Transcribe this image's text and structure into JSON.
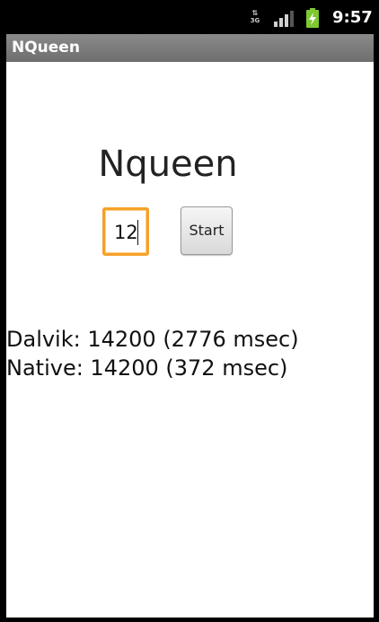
{
  "status_bar": {
    "network_type": "3G",
    "time": "9:57",
    "icons": [
      "data-arrows-icon",
      "signal-strength-icon",
      "battery-charging-icon"
    ],
    "battery_color": "#7ec832"
  },
  "app": {
    "title": "NQueen"
  },
  "main": {
    "heading": "Nqueen",
    "board_size_value": "12",
    "start_label": "Start",
    "dalvik_result": "Dalvik: 14200 (2776 msec)",
    "native_result": "Native: 14200 (372 msec)"
  },
  "colors": {
    "title_bar": "#7c7c7c",
    "focus_border": "#f4a12a",
    "background": "#ffffff"
  }
}
